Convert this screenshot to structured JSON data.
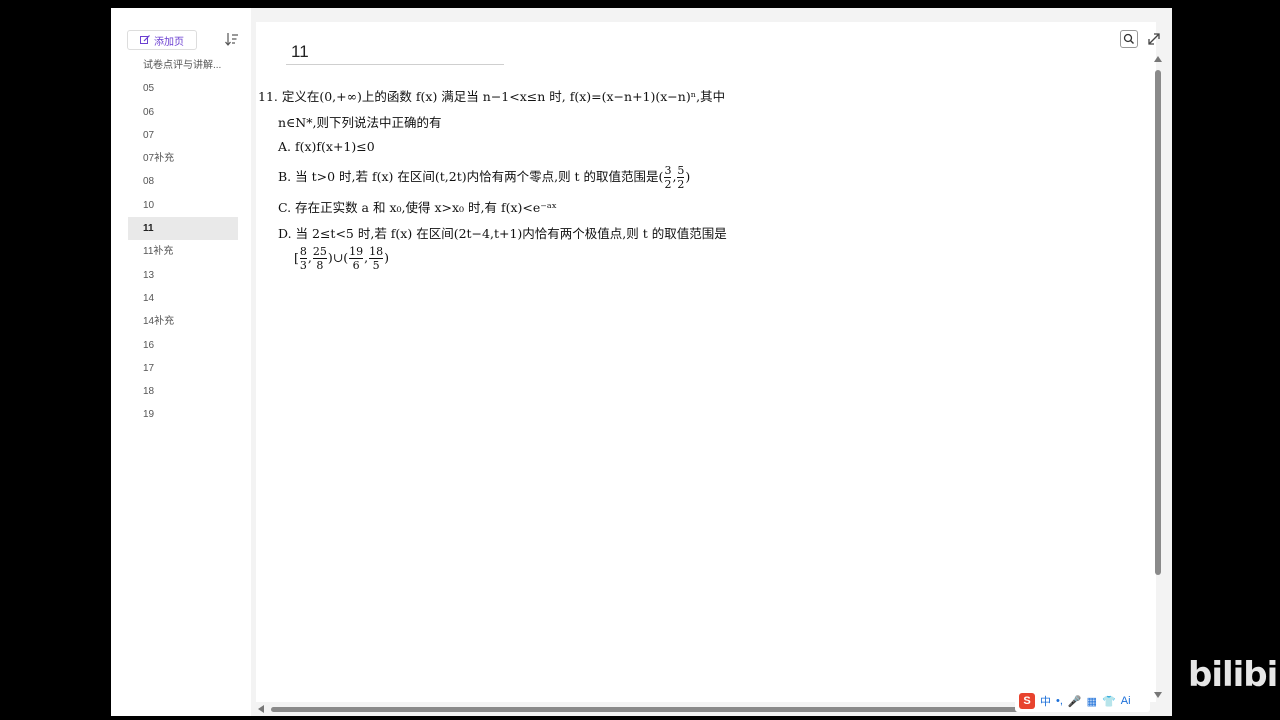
{
  "sidebar": {
    "add_page_label": "添加页",
    "items": [
      {
        "label": "试卷点评与讲解...",
        "active": false
      },
      {
        "label": "05",
        "active": false
      },
      {
        "label": "06",
        "active": false
      },
      {
        "label": "07",
        "active": false
      },
      {
        "label": "07补充",
        "active": false
      },
      {
        "label": "08",
        "active": false
      },
      {
        "label": "10",
        "active": false
      },
      {
        "label": "11",
        "active": true
      },
      {
        "label": "11补充",
        "active": false
      },
      {
        "label": "13",
        "active": false
      },
      {
        "label": "14",
        "active": false
      },
      {
        "label": "14补充",
        "active": false
      },
      {
        "label": "16",
        "active": false
      },
      {
        "label": "17",
        "active": false
      },
      {
        "label": "18",
        "active": false
      },
      {
        "label": "19",
        "active": false
      }
    ]
  },
  "page": {
    "title": "11"
  },
  "question": {
    "line1": "11. 定义在(0,+∞)上的函数 f(x) 满足当 n−1<x≤n 时, f(x)=(x−n+1)(x−n)ⁿ,其中",
    "line2": "n∈N*,则下列说法中正确的有",
    "option_a": "A. f(x)f(x+1)≤0",
    "option_b_text": "B. 当 t>0 时,若 f(x) 在区间(t,2t)内恰有两个零点,则 t 的取值范围是(",
    "option_b_frac1_num": "3",
    "option_b_frac1_den": "2",
    "option_b_frac2_num": "5",
    "option_b_frac2_den": "2",
    "option_c": "C. 存在正实数 a 和 x₀,使得 x>x₀ 时,有 f(x)<e⁻ᵃˣ",
    "option_d_text": "D. 当 2≤t<5 时,若 f(x) 在区间(2t−4,t+1)内恰有两个极值点,则 t 的取值范围是",
    "option_d_f1_num": "8",
    "option_d_f1_den": "3",
    "option_d_f2_num": "25",
    "option_d_f2_den": "8",
    "option_d_f3_num": "19",
    "option_d_f3_den": "6",
    "option_d_f4_num": "18",
    "option_d_f4_den": "5"
  },
  "ime": {
    "label_zhong": "中",
    "label_ai": "Ai"
  },
  "watermark": "bilibili"
}
